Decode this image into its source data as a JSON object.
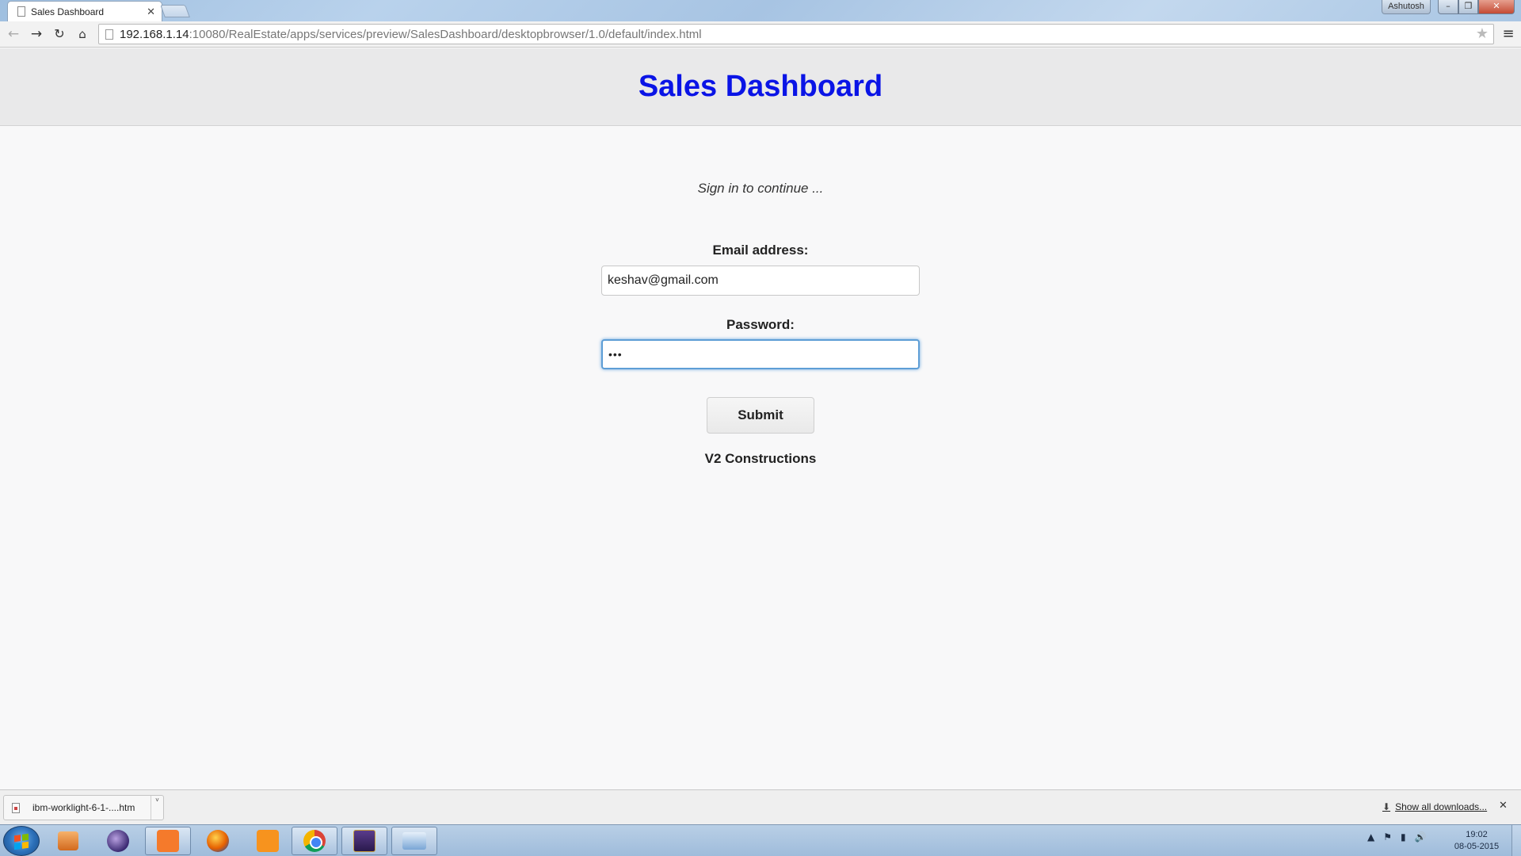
{
  "browser": {
    "tab_title": "Sales Dashboard",
    "tab_close": "✕",
    "user_name": "Ashutosh",
    "url_host": "192.168.1.14",
    "url_rest": ":10080/RealEstate/apps/services/preview/SalesDashboard/desktopbrowser/1.0/default/index.html",
    "icons": {
      "back": "←",
      "forward": "→",
      "reload": "↻",
      "home": "⌂",
      "star": "★",
      "menu": "≡",
      "minimize": "–",
      "maximize": "❐",
      "close": "✕"
    }
  },
  "page": {
    "title": "Sales Dashboard",
    "subtitle": "Sign in to continue ...",
    "email_label": "Email address:",
    "email_value": "keshav@gmail.com",
    "password_label": "Password:",
    "password_value": "•••",
    "submit_label": "Submit",
    "company": "V2 Constructions",
    "title_color": "#0a14e6"
  },
  "download_shelf": {
    "item_name": "ibm-worklight-6-1-....htm",
    "show_all": "Show all downloads...",
    "close": "✕",
    "arrow": "˅",
    "download_icon": "⬇"
  },
  "taskbar": {
    "apps": [
      "windows-media-player",
      "eclipse",
      "xampp",
      "firefox",
      "pdf-creator",
      "chrome",
      "java-ee",
      "explorer"
    ],
    "tray_icons": [
      "▲",
      "⚑",
      "▮",
      "🔊"
    ],
    "time": "19:02",
    "date": "08-05-2015"
  }
}
